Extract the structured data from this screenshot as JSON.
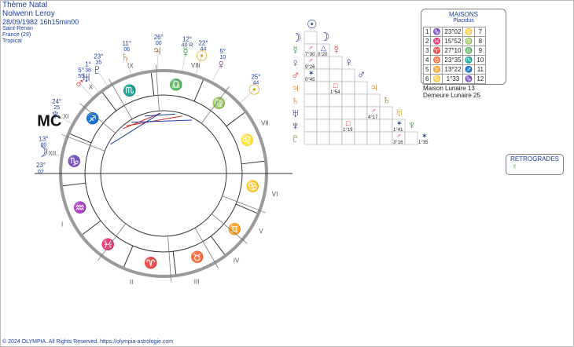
{
  "header": {
    "title": "Thème Natal",
    "name": "Nolwenn Leroy",
    "datetime": "28/09/1982 16h15min00",
    "place1": "Saint-Renan",
    "place2": "France (29)",
    "system": "Tropical"
  },
  "colors": {
    "blue": "#1a3fa0",
    "red": "#d62a2a",
    "orange": "#e07d1e",
    "green": "#2f9a2f",
    "purple": "#7a3a9a",
    "gold": "#d6a400",
    "navy": "#1b2d8a",
    "brown": "#8a5a16"
  },
  "signs": [
    "Aries",
    "Taurus",
    "Gemini",
    "Cancer",
    "Leo",
    "Virgo",
    "Libra",
    "Scorpio",
    "Sagittarius",
    "Capricorn",
    "Aquarius",
    "Pisces"
  ],
  "sign_glyphs": [
    "♈",
    "♉",
    "♊",
    "♋",
    "♌",
    "♍",
    "♎",
    "♏",
    "♐",
    "♑",
    "♒",
    "♓"
  ],
  "house_numerals": [
    "I",
    "II",
    "III",
    "IV",
    "V",
    "VI",
    "VII",
    "VIII",
    "IX",
    "X",
    "XI",
    "XII"
  ],
  "angles": {
    "asc": {
      "deg": "23°",
      "min": "02"
    },
    "mc": {
      "deg": "1°",
      "min": "38",
      "symbol": "MC"
    }
  },
  "planets": [
    {
      "key": "moon",
      "glyph": "☽",
      "deg": "13°",
      "min": "00",
      "color": "#1b2d8a",
      "lon": 283.0
    },
    {
      "key": "neptune",
      "glyph": "♆",
      "deg": "24°",
      "min": "25",
      "color": "#1b2d8a",
      "lon": 264.4
    },
    {
      "key": "mars",
      "glyph": "♂",
      "deg": "5°",
      "min": "55",
      "color": "#d62a2a",
      "lon": 245.9
    },
    {
      "key": "uranus",
      "glyph": "♅",
      "deg": "1°",
      "min": "38",
      "color": "#1b2d8a",
      "lon": 241.6
    },
    {
      "key": "pluto",
      "glyph": "♇",
      "deg": "23°",
      "min": "35",
      "color": "#1b2d8a",
      "lon": 235.6
    },
    {
      "key": "saturn",
      "glyph": "♄",
      "deg": "11°",
      "min": "06",
      "color": "#e07d1e",
      "lon": 221.1
    },
    {
      "key": "jupiter",
      "glyph": "♃",
      "deg": "26°",
      "min": "00",
      "color": "#8a5a16",
      "lon": 206.0
    },
    {
      "key": "sun",
      "glyph": "☉",
      "deg": "22°",
      "min": "44",
      "color": "#d6a400",
      "lon": 185.0
    },
    {
      "key": "mercury",
      "glyph": "☿",
      "deg": "12°",
      "min": "40 R",
      "color": "#2f9a2f",
      "lon": 192.7
    },
    {
      "key": "venus",
      "glyph": "♀",
      "deg": "5°",
      "min": "10",
      "color": "#7a3a9a",
      "lon": 175.2
    },
    {
      "key": "sun2",
      "glyph": "☉",
      "deg": "25°",
      "min": "44",
      "color": "#d6a400",
      "lon": 155.7
    }
  ],
  "aspectarian": {
    "rows": [
      {
        "glyph": "☽",
        "color": "#1b2d8a",
        "cells": []
      },
      {
        "glyph": "☿",
        "color": "#2f9a2f",
        "cells": [
          {
            "sym": "♂",
            "c": "#d62a2a",
            "val": "7°30"
          },
          {
            "sym": "△",
            "c": "#1a3fa0",
            "val": "0°20"
          }
        ]
      },
      {
        "glyph": "♀",
        "color": "#7a3a9a",
        "cells": [
          {
            "sym": "♂",
            "c": "#d62a2a",
            "val": "9°26"
          }
        ]
      },
      {
        "glyph": "♂",
        "color": "#d62a2a",
        "cells": [
          {
            "sym": "✶",
            "c": "#1a3fa0",
            "val": "0°45"
          }
        ]
      },
      {
        "glyph": "♃",
        "color": "#e07d1e",
        "cells": [
          {
            "sym": "□",
            "c": "#d62a2a",
            "val": "1°54",
            "col": 2
          }
        ]
      },
      {
        "glyph": "♄",
        "color": "#e07d1e",
        "cells": []
      },
      {
        "glyph": "♅",
        "color": "#1b2d8a",
        "cells": [
          {
            "sym": "♂",
            "c": "#d62a2a",
            "val": "4°17",
            "col": 5
          }
        ]
      },
      {
        "glyph": "♆",
        "color": "#1b2d8a",
        "cells": [
          {
            "sym": "□",
            "c": "#d62a2a",
            "val": "1°19",
            "col": 3
          },
          {
            "sym": "✶",
            "c": "#1a3fa0",
            "val": "1°41",
            "col": 7
          }
        ]
      },
      {
        "glyph": "♇",
        "color": "#8a5a16",
        "cells": [
          {
            "sym": "♂",
            "c": "#d62a2a",
            "val": "3°16",
            "col": 7
          },
          {
            "sym": "✶",
            "c": "#1a3fa0",
            "val": "1°35",
            "col": 9
          }
        ]
      }
    ],
    "diag": [
      "☉",
      "☽",
      "☿",
      "♀",
      "♂",
      "♃",
      "♄",
      "♅",
      "♆"
    ]
  },
  "houses": {
    "title": "MAISONS",
    "subtitle": "Placidus",
    "rows": [
      {
        "l": "1",
        "g": "♑",
        "v": "23°02",
        "g2": "♋",
        "n": "7"
      },
      {
        "l": "2",
        "g": "♓",
        "v": "15°52",
        "g2": "♍",
        "n": "8"
      },
      {
        "l": "3",
        "g": "♈",
        "v": "27°10",
        "g2": "♎",
        "n": "9"
      },
      {
        "l": "4",
        "g": "♉",
        "v": "23°35",
        "g2": "♏",
        "n": "10"
      },
      {
        "l": "5",
        "g": "♊",
        "v": "13°22",
        "g2": "♐",
        "n": "11"
      },
      {
        "l": "6",
        "g": "♋",
        "v": "1°33",
        "g2": "♑",
        "n": "12"
      }
    ]
  },
  "lunar": {
    "l1": "Maison Lunaire 13",
    "l2": "Demeure Lunaire 25"
  },
  "retrogrades": {
    "title": "RETROGRADES",
    "glyph": "☿"
  },
  "footer": "© 2024 OLYMPIA. All Rights Reserved. https://olympia-astrologie.com"
}
